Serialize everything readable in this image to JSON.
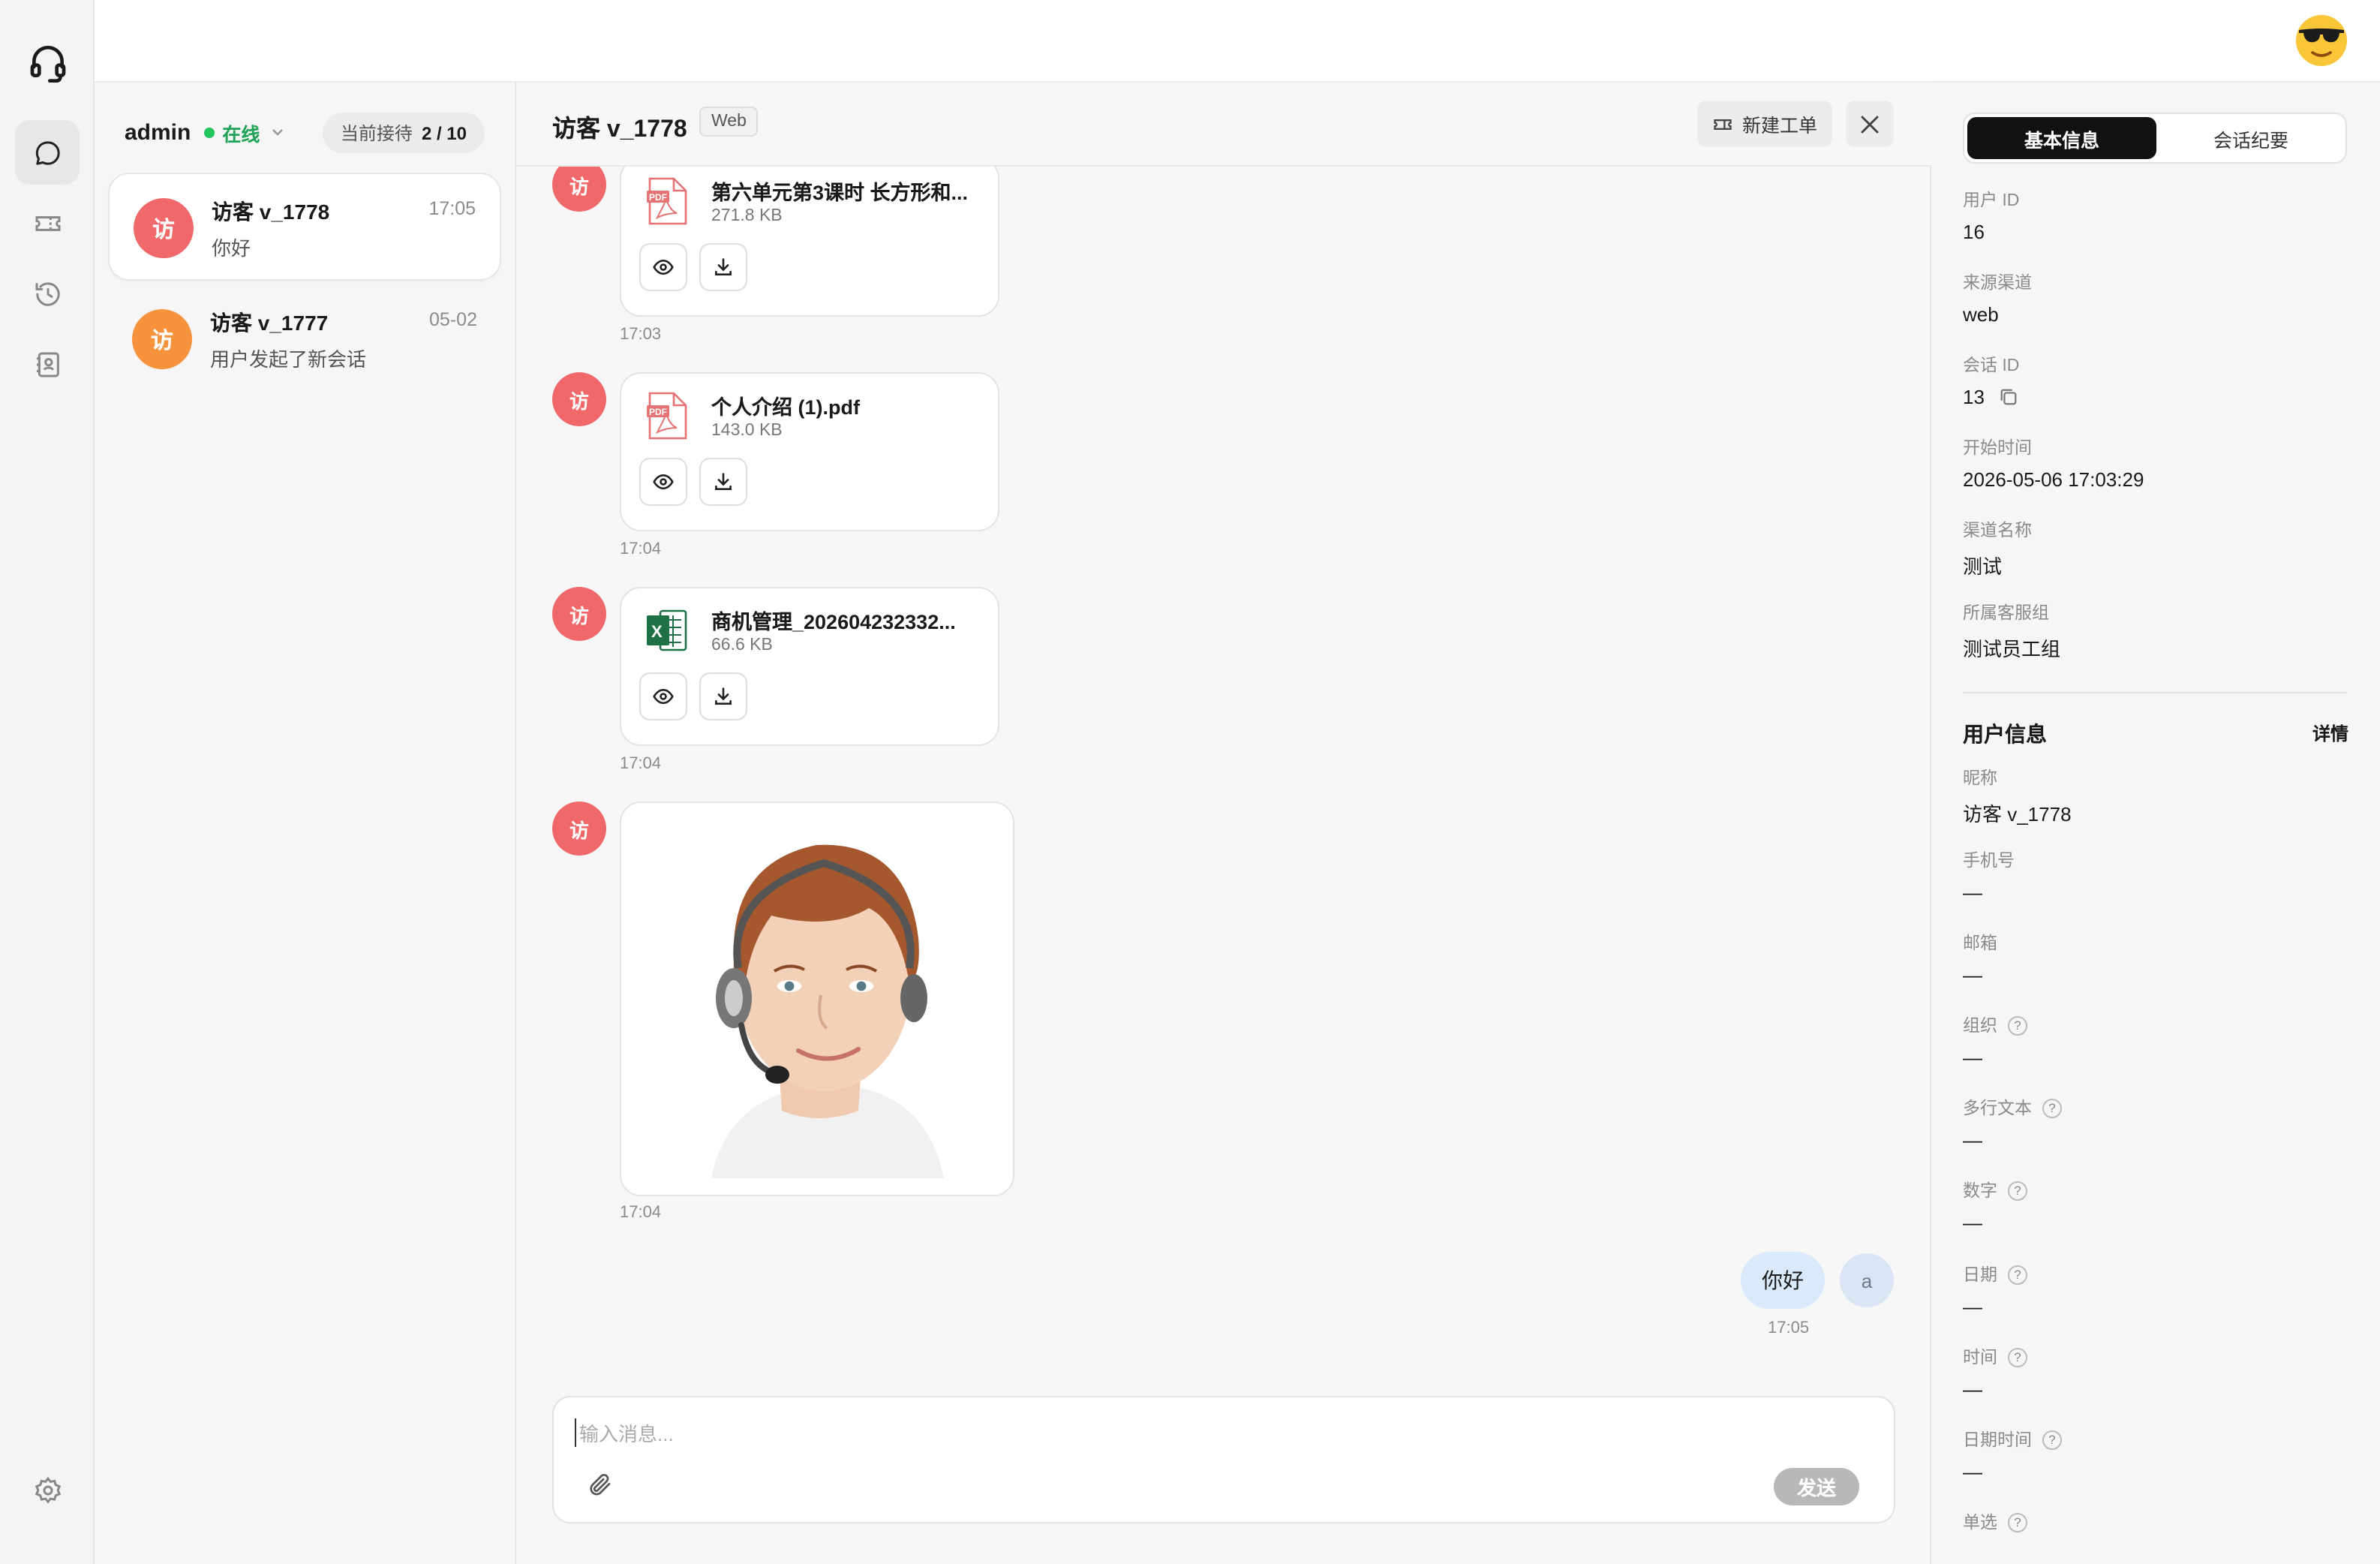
{
  "colors": {
    "online": "#22c55e",
    "visitor_avatar_red": "#f0686a",
    "visitor_avatar_orange": "#f7933c",
    "outgoing_bubble": "#dbeafb",
    "segment_active": "#111111"
  },
  "icons": {
    "logo": "headset-icon",
    "nav": [
      "chat-bubble-icon",
      "ticket-icon",
      "history-icon",
      "contacts-book-icon"
    ],
    "settings": "gear-icon",
    "user": "sunglasses-emoji-icon"
  },
  "agent": {
    "name": "admin",
    "status": "在线",
    "queue_label": "当前接待",
    "queue_value": "2 / 10"
  },
  "conversations": [
    {
      "avatar": "访",
      "name": "访客 v_1778",
      "time": "17:05",
      "preview": "你好"
    },
    {
      "avatar": "访",
      "name": "访客 v_1777",
      "time": "05-02",
      "preview": "用户发起了新会话"
    }
  ],
  "chat": {
    "title": "访客 v_1778",
    "channel_tag": "Web",
    "new_ticket_label": "新建工单",
    "visitor_avatar": "访",
    "messages": [
      {
        "type": "file",
        "file_type": "pdf",
        "name": "第六单元第3课时 长方形和...",
        "size": "271.8 KB",
        "time": "17:03"
      },
      {
        "type": "file",
        "file_type": "pdf",
        "name": "个人介绍 (1).pdf",
        "size": "143.0 KB",
        "time": "17:04"
      },
      {
        "type": "file",
        "file_type": "excel",
        "name": "商机管理_202604232332...",
        "size": "66.6 KB",
        "time": "17:04"
      },
      {
        "type": "image",
        "time": "17:04"
      }
    ],
    "outgoing": {
      "text": "你好",
      "avatar": "a",
      "time": "17:05"
    },
    "composer": {
      "placeholder": "输入消息...",
      "send_label": "发送"
    }
  },
  "info": {
    "tabs": [
      "基本信息",
      "会话纪要"
    ],
    "basic": [
      {
        "label": "用户 ID",
        "value": "16"
      },
      {
        "label": "来源渠道",
        "value": "web"
      },
      {
        "label": "会话 ID",
        "value": "13"
      },
      {
        "label": "开始时间",
        "value": "2026-05-06 17:03:29"
      },
      {
        "label": "渠道名称",
        "value": "测试"
      },
      {
        "label": "所属客服组",
        "value": "测试员工组"
      }
    ],
    "user_section_title": "用户信息",
    "user_section_link": "详情",
    "user": [
      {
        "label": "昵称",
        "value": "访客 v_1778"
      },
      {
        "label": "手机号",
        "value": "—"
      },
      {
        "label": "邮箱",
        "value": "—"
      },
      {
        "label": "组织",
        "value": "—",
        "help": "?"
      },
      {
        "label": "多行文本",
        "value": "—",
        "help": "?"
      },
      {
        "label": "数字",
        "value": "—",
        "help": "?"
      },
      {
        "label": "日期",
        "value": "—",
        "help": "?"
      },
      {
        "label": "时间",
        "value": "—",
        "help": "?"
      },
      {
        "label": "日期时间",
        "value": "—",
        "help": "?"
      },
      {
        "label": "单选",
        "value": "",
        "help": "?"
      }
    ]
  }
}
